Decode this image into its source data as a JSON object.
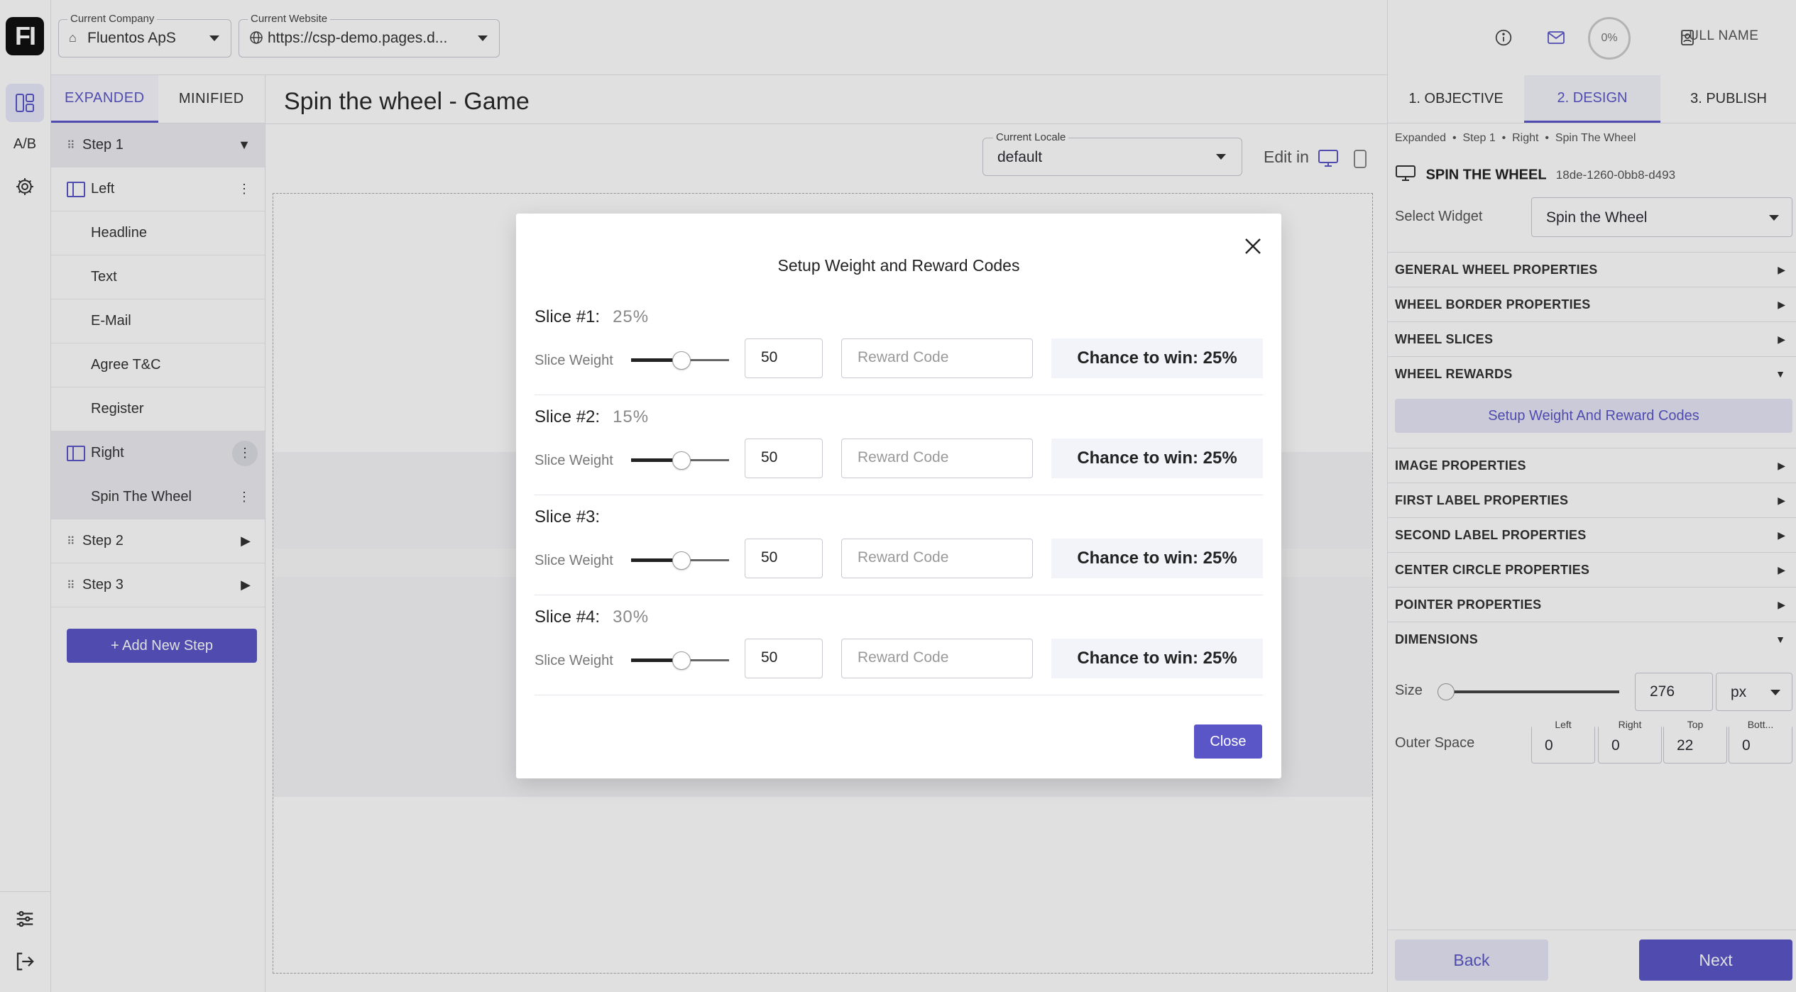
{
  "app": {
    "logo_text": "FI",
    "rail": {
      "ab_label": "A/B"
    }
  },
  "topbar": {
    "company": {
      "label": "Current Company",
      "value": "Fluentos ApS"
    },
    "website": {
      "label": "Current Website",
      "value": "https://csp-demo.pages.d..."
    }
  },
  "steps_panel": {
    "tabs": [
      "EXPANDED",
      "MINIFIED"
    ],
    "tree": [
      {
        "label": "Step 1",
        "kind": "step"
      },
      {
        "label": "Left",
        "kind": "column"
      },
      {
        "label": "Headline",
        "kind": "widget"
      },
      {
        "label": "Text",
        "kind": "widget"
      },
      {
        "label": "E-Mail",
        "kind": "widget"
      },
      {
        "label": "Agree T&C",
        "kind": "widget"
      },
      {
        "label": "Register",
        "kind": "widget"
      },
      {
        "label": "Right",
        "kind": "column"
      },
      {
        "label": "Spin The Wheel",
        "kind": "widget"
      },
      {
        "label": "Step 2",
        "kind": "step"
      },
      {
        "label": "Step 3",
        "kind": "step"
      }
    ],
    "add_step_label": "+ Add New Step"
  },
  "canvas": {
    "title": "Spin the wheel - Game",
    "locale": {
      "label": "Current Locale",
      "value": "default"
    },
    "edit_in_label": "Edit in"
  },
  "right_panel": {
    "progress": "0%",
    "user_name": "FULL NAME",
    "tabs": [
      "1. OBJECTIVE",
      "2. DESIGN",
      "3. PUBLISH"
    ],
    "breadcrumb": [
      "Expanded",
      "Step 1",
      "Right",
      "Spin The Wheel"
    ],
    "widget_title": "SPIN THE WHEEL",
    "widget_id": "18de-1260-0bb8-d493",
    "select_widget_label": "Select Widget",
    "select_widget_value": "Spin the Wheel",
    "sections": [
      "GENERAL WHEEL PROPERTIES",
      "WHEEL BORDER PROPERTIES",
      "WHEEL SLICES",
      "WHEEL REWARDS",
      "IMAGE PROPERTIES",
      "FIRST LABEL PROPERTIES",
      "SECOND LABEL PROPERTIES",
      "CENTER CIRCLE PROPERTIES",
      "POINTER PROPERTIES",
      "DIMENSIONS"
    ],
    "setup_button": "Setup Weight And Reward Codes",
    "size_label": "Size",
    "size_value": "276",
    "size_unit": "px",
    "outer_space_label": "Outer Space",
    "outer_space": [
      {
        "label": "Left",
        "value": "0"
      },
      {
        "label": "Right",
        "value": "0"
      },
      {
        "label": "Top",
        "value": "22"
      },
      {
        "label": "Bott...",
        "value": "0"
      }
    ],
    "back_label": "Back",
    "next_label": "Next"
  },
  "modal": {
    "title": "Setup Weight and Reward Codes",
    "weight_label": "Slice Weight",
    "reward_placeholder": "Reward Code",
    "slices": [
      {
        "name": "Slice #1:",
        "percent": "25%",
        "weight": "50",
        "chance": "Chance to win: 25%"
      },
      {
        "name": "Slice #2:",
        "percent": "15%",
        "weight": "50",
        "chance": "Chance to win: 25%"
      },
      {
        "name": "Slice #3:",
        "percent": "",
        "weight": "50",
        "chance": "Chance to win: 25%"
      },
      {
        "name": "Slice #4:",
        "percent": "30%",
        "weight": "50",
        "chance": "Chance to win: 25%"
      }
    ],
    "close_label": "Close"
  }
}
